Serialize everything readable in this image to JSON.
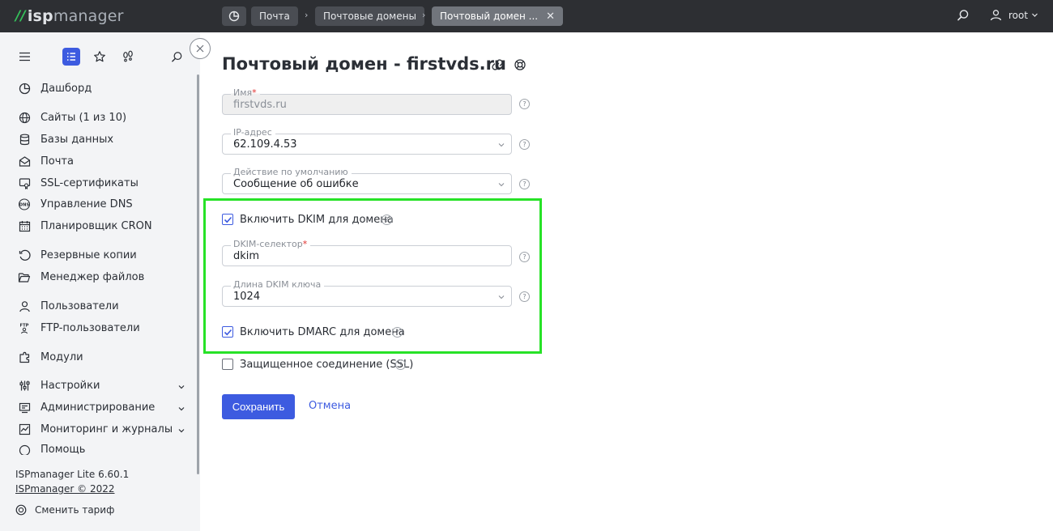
{
  "app": {
    "logo_isp": "isp",
    "logo_manager": "manager"
  },
  "breadcrumbs": [
    {
      "label": "Почта"
    },
    {
      "label": "Почтовые домены"
    },
    {
      "label": "Почтовый домен ..."
    }
  ],
  "user": {
    "name": "root"
  },
  "sidebar": {
    "items": [
      {
        "label": "Дашборд",
        "icon": "dashboard-icon"
      },
      {
        "label": "Сайты (1 из 10)",
        "icon": "globe-icon"
      },
      {
        "label": "Базы данных",
        "icon": "database-icon"
      },
      {
        "label": "Почта",
        "icon": "mail-icon"
      },
      {
        "label": "SSL-сертификаты",
        "icon": "certificate-icon"
      },
      {
        "label": "Управление DNS",
        "icon": "dns-icon"
      },
      {
        "label": "Планировщик CRON",
        "icon": "calendar-icon"
      },
      {
        "label": "Резервные копии",
        "icon": "backup-icon"
      },
      {
        "label": "Менеджер файлов",
        "icon": "folder-icon"
      },
      {
        "label": "Пользователи",
        "icon": "user-icon"
      },
      {
        "label": "FTP-пользователи",
        "icon": "ftp-icon"
      },
      {
        "label": "Модули",
        "icon": "modules-icon"
      },
      {
        "label": "Настройки",
        "icon": "settings-icon"
      },
      {
        "label": "Администрирование",
        "icon": "admin-icon"
      },
      {
        "label": "Мониторинг и журналы",
        "icon": "monitoring-icon"
      },
      {
        "label": "Помощь",
        "icon": "help-icon"
      }
    ],
    "version": "ISPmanager Lite 6.60.1",
    "copyright": "ISPmanager © 2022",
    "change_plan": "Сменить тариф"
  },
  "page": {
    "title": "Почтовый домен - firstvds.ru",
    "fields": {
      "name": {
        "label": "Имя",
        "required_mark": "*",
        "value": "firstvds.ru"
      },
      "ip": {
        "label": "IP-адрес",
        "value": "62.109.4.53"
      },
      "default_action": {
        "label": "Действие по умолчанию",
        "value": "Сообщение об ошибке"
      },
      "dkim_enable": {
        "label": "Включить DKIM для домена",
        "checked": true
      },
      "dkim_selector": {
        "label": "DKIM-селектор",
        "required_mark": "*",
        "value": "dkim"
      },
      "dkim_length": {
        "label": "Длина DKIM ключа",
        "value": "1024"
      },
      "dmarc_enable": {
        "label": "Включить DMARC для домена",
        "checked": true
      },
      "ssl": {
        "label": "Защищенное соединение (SSL)",
        "checked": false
      }
    },
    "help_glyph": "?",
    "save_label": "Сохранить",
    "cancel_label": "Отмена"
  },
  "colors": {
    "accent": "#3d5be0",
    "highlight": "#27e227",
    "topbar": "#2d2f33",
    "brand_green": "#34c05a"
  }
}
